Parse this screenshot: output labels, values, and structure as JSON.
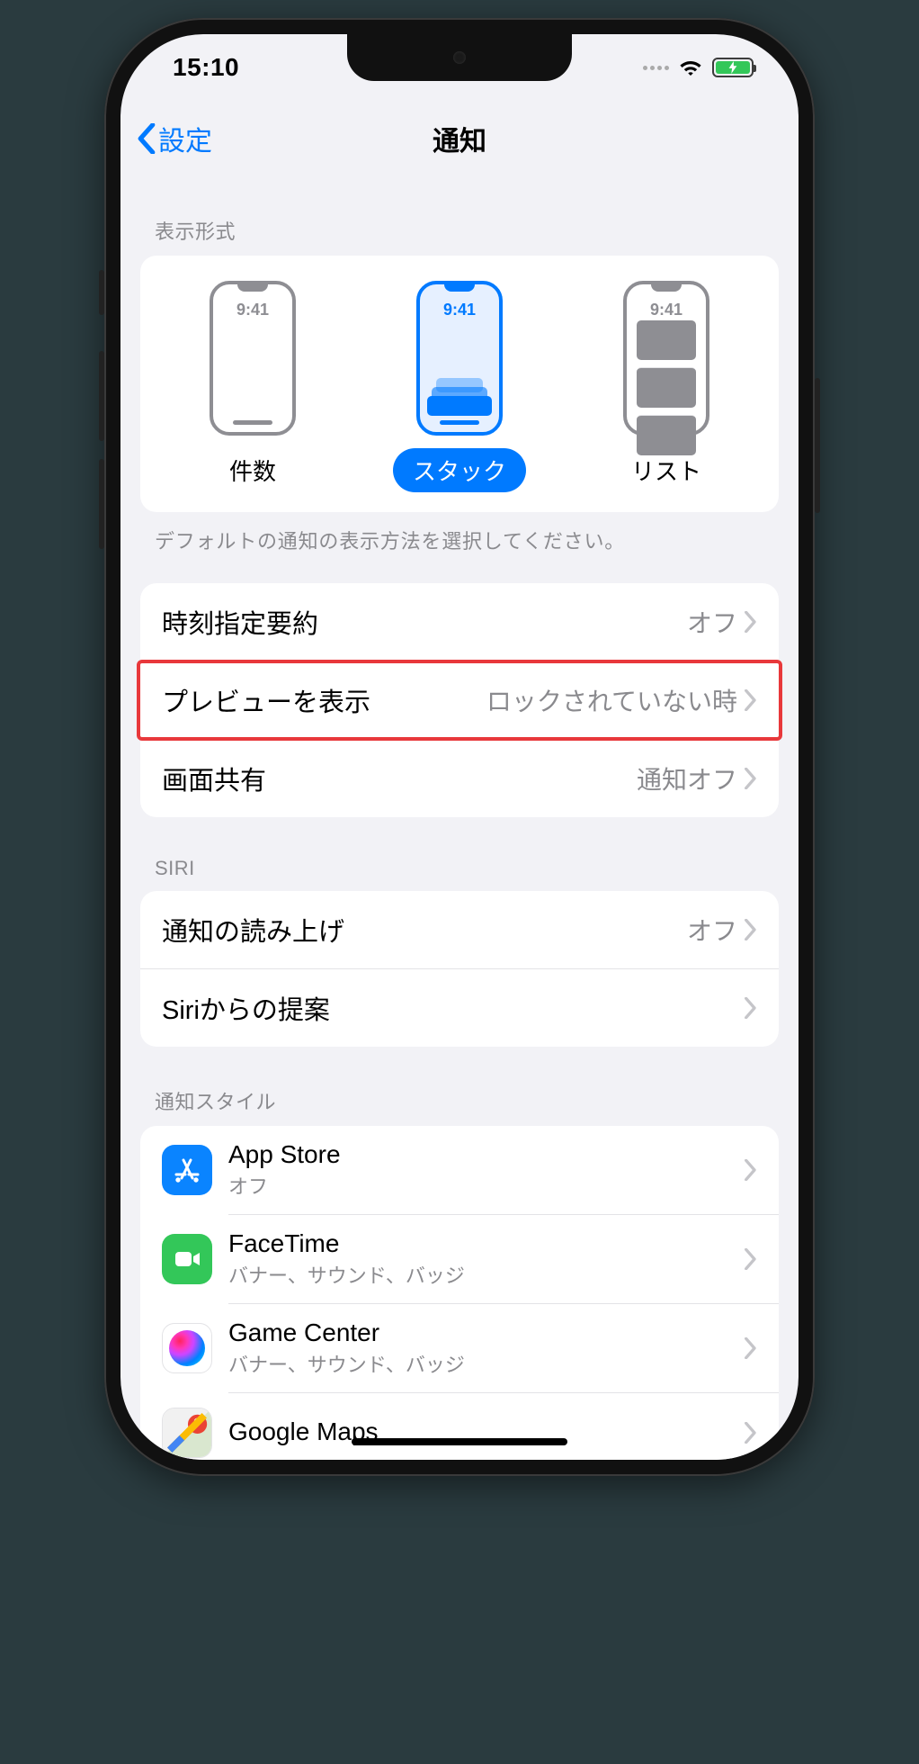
{
  "statusbar": {
    "time": "15:10"
  },
  "nav": {
    "back_label": "設定",
    "title": "通知"
  },
  "display_as": {
    "header": "表示形式",
    "mini_time": "9:41",
    "options": [
      {
        "label": "件数",
        "selected": false
      },
      {
        "label": "スタック",
        "selected": true
      },
      {
        "label": "リスト",
        "selected": false
      }
    ],
    "footer": "デフォルトの通知の表示方法を選択してください。"
  },
  "group1": {
    "rows": [
      {
        "label": "時刻指定要約",
        "value": "オフ"
      },
      {
        "label": "プレビューを表示",
        "value": "ロックされていない時",
        "highlighted": true
      },
      {
        "label": "画面共有",
        "value": "通知オフ"
      }
    ]
  },
  "siri": {
    "header": "SIRI",
    "rows": [
      {
        "label": "通知の読み上げ",
        "value": "オフ"
      },
      {
        "label": "Siriからの提案",
        "value": ""
      }
    ]
  },
  "style": {
    "header": "通知スタイル",
    "apps": [
      {
        "name": "App Store",
        "sub": "オフ",
        "icon": "appstore"
      },
      {
        "name": "FaceTime",
        "sub": "バナー、サウンド、バッジ",
        "icon": "facetime"
      },
      {
        "name": "Game Center",
        "sub": "バナー、サウンド、バッジ",
        "icon": "gamecenter"
      },
      {
        "name": "Google Maps",
        "sub": "",
        "icon": "gmaps"
      }
    ]
  }
}
